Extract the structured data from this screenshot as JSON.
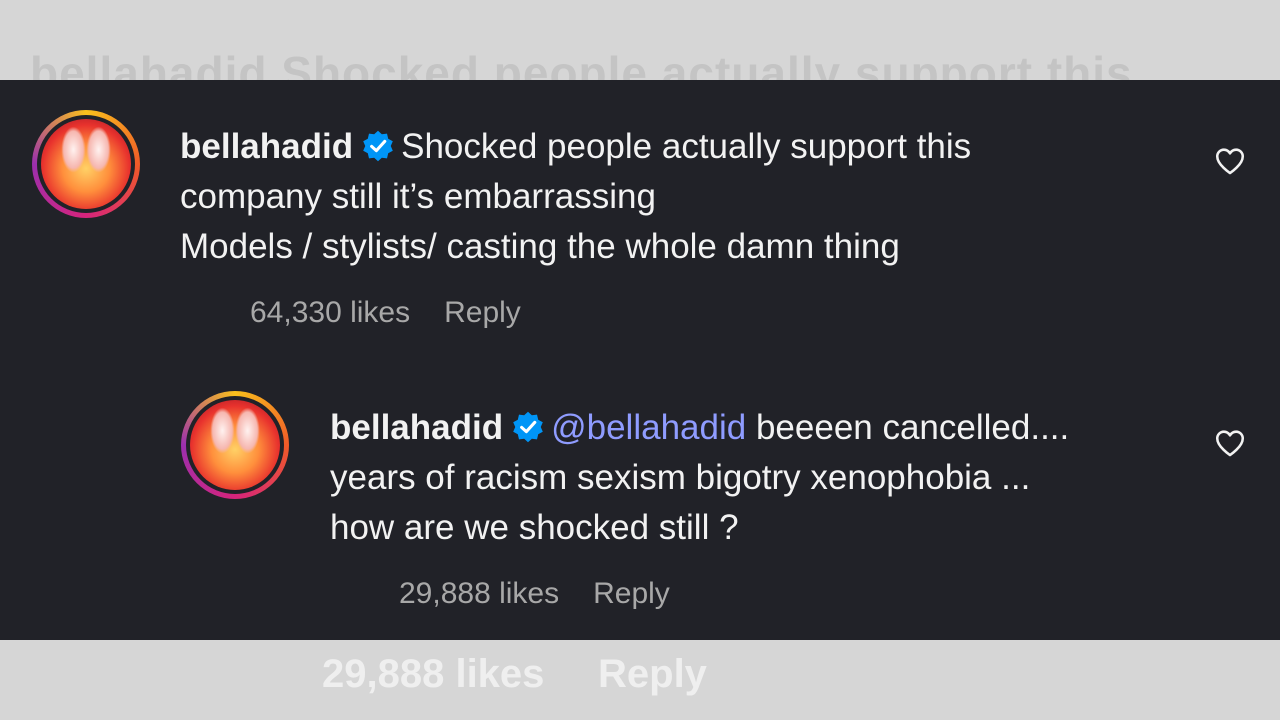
{
  "background": {
    "top_text": "bellahadid Shocked people actually support this",
    "bottom_likes": "29,888 likes",
    "bottom_reply": "Reply"
  },
  "comments": [
    {
      "username": "bellahadid",
      "verified": true,
      "lines": [
        "Shocked people actually support this",
        "company still it’s embarrassing",
        "Models / stylists/ casting the whole damn thing"
      ],
      "likes": "64,330 likes",
      "reply_label": "Reply"
    },
    {
      "username": "bellahadid",
      "verified": true,
      "mention": "@bellahadid",
      "lines": [
        "beeeen cancelled....",
        "years of racism sexism bigotry xenophobia ...",
        "how are we shocked still ?"
      ],
      "likes": "29,888 likes",
      "reply_label": "Reply"
    }
  ],
  "icons": {
    "verified": "verified-badge-icon",
    "like": "heart-outline-icon"
  },
  "colors": {
    "panel_bg": "#212228",
    "text": "#f2f2f2",
    "meta": "#a8a8a8",
    "mention": "#8f9cff",
    "verified": "#0095f6"
  }
}
